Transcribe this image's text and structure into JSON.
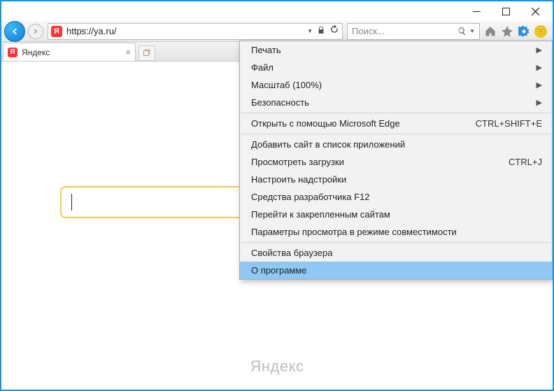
{
  "window": {
    "url": "https://ya.ru/",
    "search_placeholder": "Поиск..."
  },
  "tab": {
    "title": "Яндекс"
  },
  "page": {
    "brand": "Яндекс"
  },
  "menu": {
    "print": "Печать",
    "file": "Файл",
    "zoom": "Масштаб (100%)",
    "safety": "Безопасность",
    "edge": "Открыть с помощью Microsoft Edge",
    "edge_sc": "CTRL+SHIFT+E",
    "addsite": "Добавить сайт в список приложений",
    "downloads": "Просмотреть загрузки",
    "downloads_sc": "CTRL+J",
    "addons": "Настроить надстройки",
    "f12": "Средства разработчика F12",
    "pinned": "Перейти к закрепленным сайтам",
    "compat": "Параметры просмотра в режиме совместимости",
    "props": "Свойства браузера",
    "about": "О программе"
  }
}
